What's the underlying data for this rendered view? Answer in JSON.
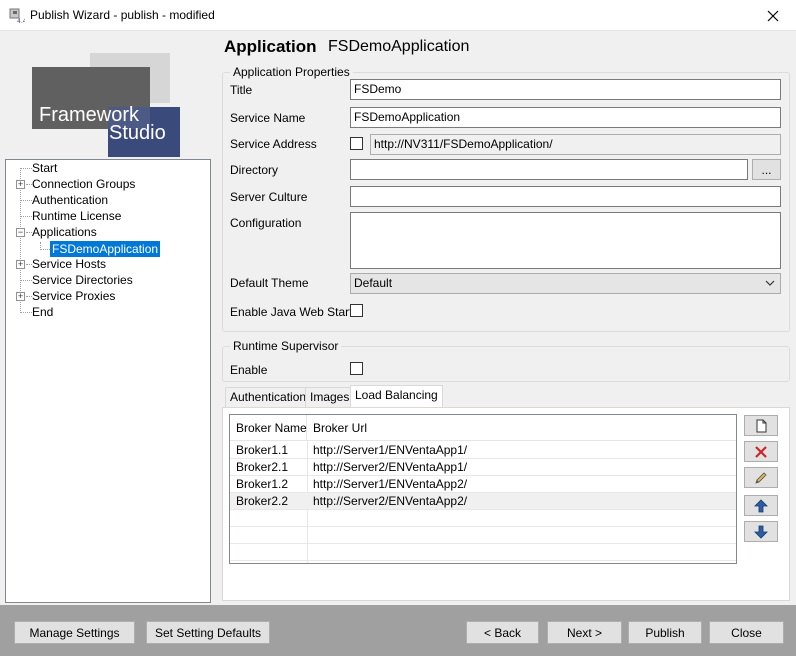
{
  "window": {
    "title": "Publish Wizard - publish - modified",
    "icon": "publish-wizard-icon"
  },
  "logo": {
    "line1": "Framework",
    "line2": "Studio",
    "colors": {
      "navy": "#3a4a7a",
      "gray": "#5a5a5a",
      "light": "#d0d0d0"
    }
  },
  "tree": {
    "items": [
      {
        "label": "Start",
        "expander": false
      },
      {
        "label": "Connection Groups",
        "expander": true
      },
      {
        "label": "Authentication",
        "expander": false
      },
      {
        "label": "Runtime License",
        "expander": false
      },
      {
        "label": "Applications",
        "expander": "expanded"
      },
      {
        "label": "FSDemoApplication",
        "expander": false,
        "selected": true
      },
      {
        "label": "Service Hosts",
        "expander": true
      },
      {
        "label": "Service Directories",
        "expander": false
      },
      {
        "label": "Service Proxies",
        "expander": true
      },
      {
        "label": "End",
        "expander": false
      }
    ]
  },
  "header": {
    "label": "Application",
    "value": "FSDemoApplication"
  },
  "app_props": {
    "group_title": "Application Properties",
    "title_label": "Title",
    "title_value": "FSDemo",
    "service_name_label": "Service Name",
    "service_name_value": "FSDemoApplication",
    "service_address_label": "Service Address",
    "service_address_checked": false,
    "service_address_value": "http://NV311/FSDemoApplication/",
    "directory_label": "Directory",
    "directory_value": "",
    "browse_label": "...",
    "server_culture_label": "Server Culture",
    "server_culture_value": "",
    "configuration_label": "Configuration",
    "configuration_value": "",
    "default_theme_label": "Default Theme",
    "default_theme_value": "Default",
    "java_web_start_label": "Enable Java Web Start",
    "java_web_start_checked": false
  },
  "runtime_supervisor": {
    "group_title": "Runtime Supervisor",
    "enable_label": "Enable",
    "enable_checked": false
  },
  "tabs": [
    {
      "label": "Authentication",
      "active": false
    },
    {
      "label": "Images",
      "active": false
    },
    {
      "label": "Load Balancing",
      "active": true
    }
  ],
  "load_balancing": {
    "columns": [
      "Broker Name",
      "Broker Url"
    ],
    "rows": [
      {
        "name": "Broker1.1",
        "url": "http://Server1/ENVentaApp1/"
      },
      {
        "name": "Broker2.1",
        "url": "http://Server2/ENVentaApp1/"
      },
      {
        "name": "Broker1.2",
        "url": "http://Server1/ENVentaApp2/"
      },
      {
        "name": "Broker2.2",
        "url": "http://Server2/ENVentaApp2/",
        "selected": true
      }
    ],
    "side_buttons": [
      "new-icon",
      "delete-icon",
      "edit-icon",
      "move-up-icon",
      "move-down-icon"
    ]
  },
  "footer": {
    "manage_settings": "Manage Settings",
    "set_defaults": "Set Setting Defaults",
    "back": "< Back",
    "next": "Next >",
    "publish": "Publish",
    "close": "Close"
  }
}
